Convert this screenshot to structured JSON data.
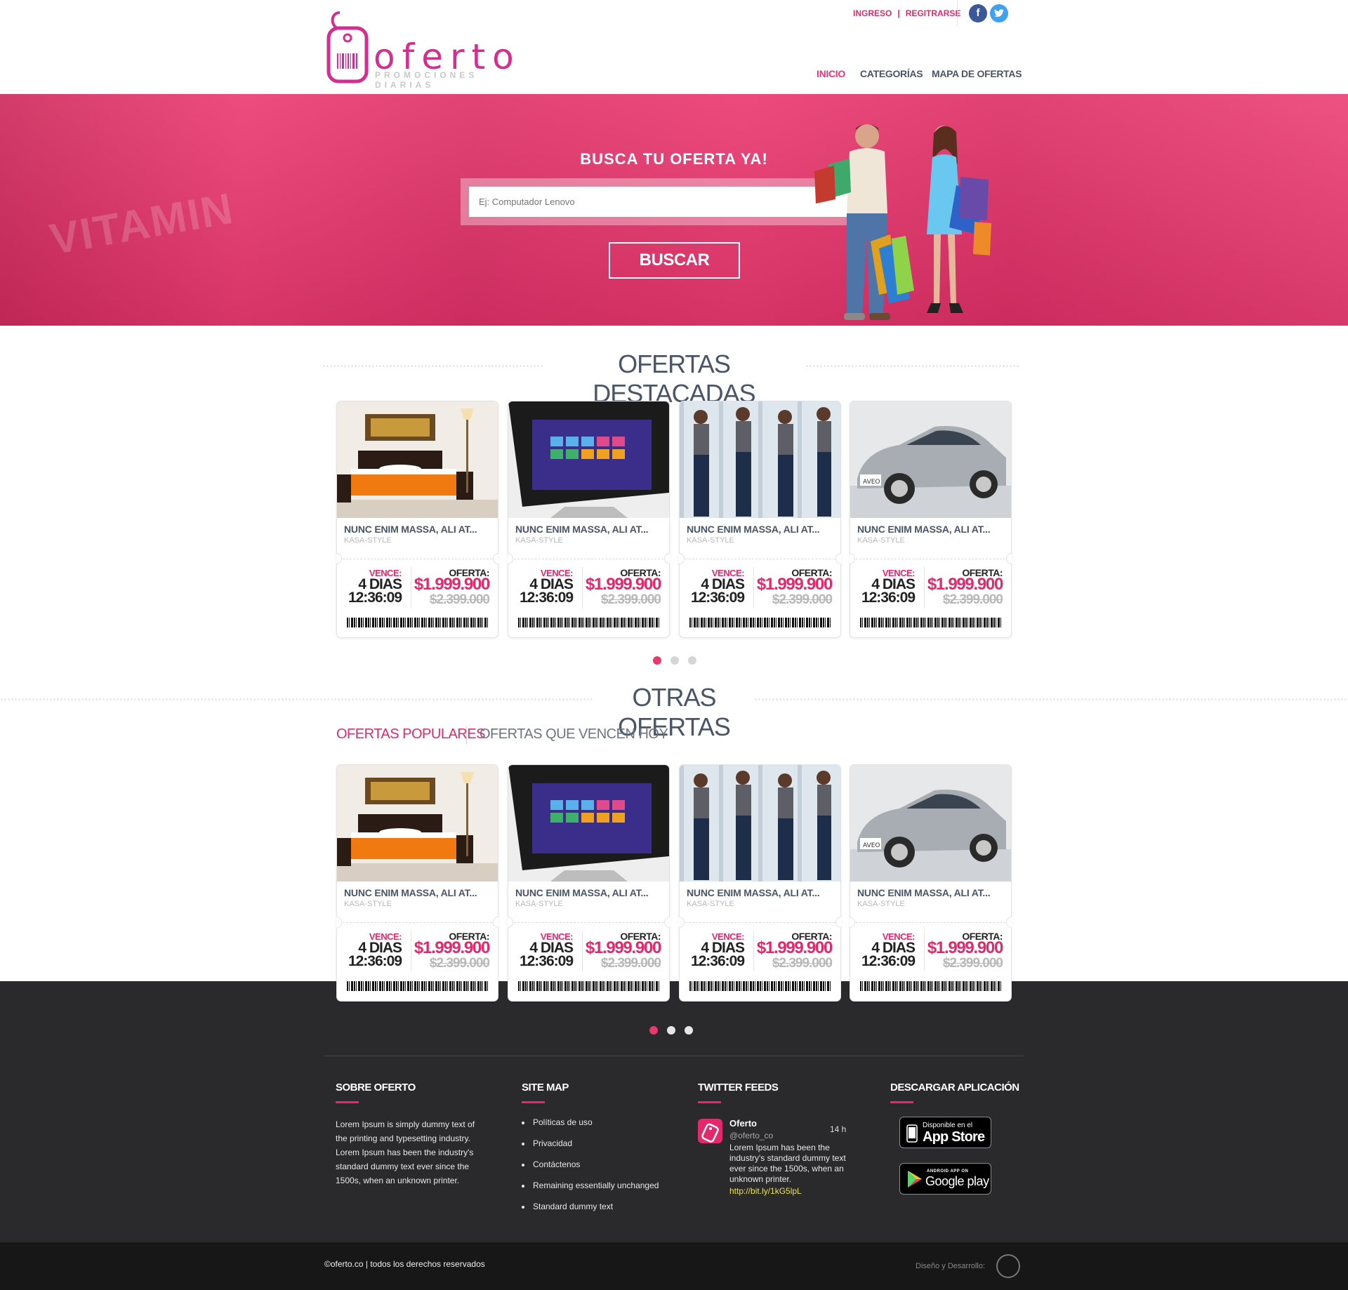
{
  "header": {
    "logo_word": "oferto",
    "logo_tagline": "PROMOCIONES DIARIAS",
    "login": "INGRESO",
    "separator": "|",
    "register": "REGITRARSE",
    "social": {
      "facebook": "f",
      "twitter": "t"
    },
    "nav": [
      "INICIO",
      "CATEGORÍAS",
      "MAPA DE OFERTAS"
    ]
  },
  "hero": {
    "title": "BUSCA TU OFERTA YA!",
    "search_placeholder": "Ej: Computador Lenovo",
    "search_button": "BUSCAR",
    "background_sign": "VITAMIN"
  },
  "featured": {
    "title": "OFERTAS DESTACADAS",
    "cards": [
      {
        "image": "bedroom-photo",
        "title": "NUNC ENIM MASSA, ALI AT...",
        "brand": "KASA-STYLE",
        "vence_label": "VENCE:",
        "days": "4 DIAS",
        "time": "12:36:09",
        "offer_label": "OFERTA:",
        "price": "$1.999.900",
        "old_price": "$2.399.000"
      },
      {
        "image": "computer-photo",
        "title": "NUNC ENIM MASSA, ALI AT...",
        "brand": "KASA-STYLE",
        "vence_label": "VENCE:",
        "days": "4 DIAS",
        "time": "12:36:09",
        "offer_label": "OFERTA:",
        "price": "$1.999.900",
        "old_price": "$2.399.000"
      },
      {
        "image": "jeans-models-photo",
        "title": "NUNC ENIM MASSA, ALI AT...",
        "brand": "KASA-STYLE",
        "vence_label": "VENCE:",
        "days": "4 DIAS",
        "time": "12:36:09",
        "offer_label": "OFERTA:",
        "price": "$1.999.900",
        "old_price": "$2.399.000"
      },
      {
        "image": "car-photo",
        "title": "NUNC ENIM MASSA, ALI AT...",
        "brand": "KASA-STYLE",
        "vence_label": "VENCE:",
        "days": "4 DIAS",
        "time": "12:36:09",
        "offer_label": "OFERTA:",
        "price": "$1.999.900",
        "old_price": "$2.399.000"
      }
    ],
    "pager": {
      "pages": 3,
      "active": 1
    }
  },
  "other": {
    "title": "OTRAS OFERTAS",
    "tabs": [
      "OFERTAS POPULARES",
      "OFERTAS QUE VENCEN HOY"
    ],
    "active_tab": 0,
    "cards": [
      {
        "image": "bedroom-photo",
        "title": "NUNC ENIM MASSA, ALI AT...",
        "brand": "KASA-STYLE",
        "vence_label": "VENCE:",
        "days": "4 DIAS",
        "time": "12:36:09",
        "offer_label": "OFERTA:",
        "price": "$1.999.900",
        "old_price": "$2.399.000"
      },
      {
        "image": "computer-photo",
        "title": "NUNC ENIM MASSA, ALI AT...",
        "brand": "KASA-STYLE",
        "vence_label": "VENCE:",
        "days": "4 DIAS",
        "time": "12:36:09",
        "offer_label": "OFERTA:",
        "price": "$1.999.900",
        "old_price": "$2.399.000"
      },
      {
        "image": "jeans-models-photo",
        "title": "NUNC ENIM MASSA, ALI AT...",
        "brand": "KASA-STYLE",
        "vence_label": "VENCE:",
        "days": "4 DIAS",
        "time": "12:36:09",
        "offer_label": "OFERTA:",
        "price": "$1.999.900",
        "old_price": "$2.399.000"
      },
      {
        "image": "car-photo",
        "title": "NUNC ENIM MASSA, ALI AT...",
        "brand": "KASA-STYLE",
        "vence_label": "VENCE:",
        "days": "4 DIAS",
        "time": "12:36:09",
        "offer_label": "OFERTA:",
        "price": "$1.999.900",
        "old_price": "$2.399.000"
      }
    ],
    "pager": {
      "pages": 3,
      "active": 1
    }
  },
  "footer": {
    "about": {
      "title": "SOBRE OFERTO",
      "text": "Lorem Ipsum is simply dummy text of the printing and typesetting industry. Lorem Ipsum has been the industry's standard dummy text ever since the 1500s, when an unknown printer."
    },
    "sitemap": {
      "title": "SITE MAP",
      "items": [
        "Políticas de uso",
        "Privacidad",
        "Contáctenos",
        "Remaining essentially unchanged",
        "Standard dummy text"
      ]
    },
    "twitter": {
      "title": "TWITTER FEEDS",
      "name": "Oferto",
      "handle": "@oferto_co",
      "time": "14 h",
      "text": "Lorem Ipsum has been the industry's standard dummy text ever since the 1500s, when an unknown printer.",
      "link": "http://bit.ly/1kG5lpL"
    },
    "apps": {
      "title": "DESCARGAR APLICACIÓN",
      "appstore_small": "Disponible en el",
      "appstore_large": "App Store",
      "play_small": "ANDROID APP ON",
      "play_large": "Google play"
    }
  },
  "bottombar": {
    "copyright": "©oferto.co | todos los derechos reservados",
    "credits": "Diseño y Desarrollo:"
  },
  "colors": {
    "accent": "#e2296c",
    "hero": "#e8396f",
    "text_dark": "#4a5568",
    "footer_bg": "#2a2a2c",
    "bottom_bg": "#171717"
  }
}
